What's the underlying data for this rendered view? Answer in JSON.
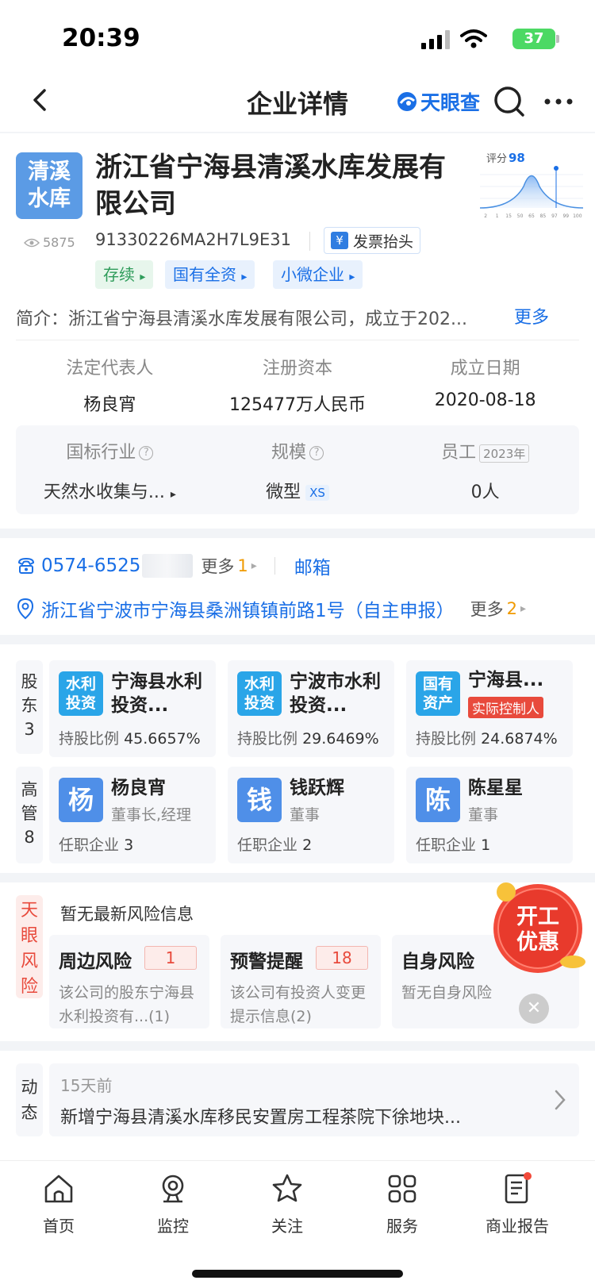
{
  "status_bar": {
    "time": "20:39",
    "battery": "37"
  },
  "nav": {
    "title": "企业详情",
    "brand": "天眼查"
  },
  "company": {
    "logo_line1": "清溪",
    "logo_line2": "水库",
    "name": "浙江省宁海县清溪水库发展有限公司",
    "views": "5875",
    "credit_code": "91330226MA2H7L9E31",
    "invoice_label": "发票抬头",
    "tags": [
      {
        "label": "存续",
        "color": "green"
      },
      {
        "label": "国有全资",
        "color": "blue"
      },
      {
        "label": "小微企业",
        "color": "blue"
      }
    ],
    "score_label": "评分",
    "score": "98",
    "score_ticks": [
      "2",
      "1",
      "15",
      "50",
      "65",
      "85",
      "97",
      "99",
      "100"
    ],
    "intro_label": "简介：",
    "intro_text": "浙江省宁海县清溪水库发展有限公司，成立于202...",
    "intro_more": "更多"
  },
  "key_info": [
    {
      "label": "法定代表人",
      "value": "杨良宵"
    },
    {
      "label": "注册资本",
      "value": "125477万人民币"
    },
    {
      "label": "成立日期",
      "value": "2020-08-18"
    }
  ],
  "info_card": {
    "industry_label": "国标行业",
    "industry_value": "天然水收集与...",
    "scale_label": "规模",
    "scale_value": "微型",
    "scale_badge": "XS",
    "staff_label": "员工",
    "staff_year": "2023年",
    "staff_value": "0人"
  },
  "contact": {
    "phone": "0574-6525",
    "phone_more": "更多",
    "phone_more_count": "1",
    "email": "邮箱",
    "address": "浙江省宁波市宁海县桑洲镇镇前路1号（自主申报）",
    "address_more": "更多",
    "address_more_count": "2"
  },
  "shareholders": {
    "side_label": [
      "股",
      "东",
      "3"
    ],
    "items": [
      {
        "icon": "水利投资",
        "name": "宁海县水利投资...",
        "ratio_label": "持股比例",
        "ratio": "45.6657%"
      },
      {
        "icon": "水利投资",
        "name": "宁波市水利投资...",
        "ratio_label": "持股比例",
        "ratio": "29.6469%"
      },
      {
        "icon": "国有资产",
        "name": "宁海县...",
        "tag": "实际控制人",
        "ratio_label": "持股比例",
        "ratio": "24.6874%"
      }
    ]
  },
  "executives": {
    "side_label": [
      "高",
      "管",
      "8"
    ],
    "items": [
      {
        "avatar": "杨",
        "name": "杨良宵",
        "role": "董事长,经理",
        "count_label": "任职企业",
        "count": "3"
      },
      {
        "avatar": "钱",
        "name": "钱跃辉",
        "role": "董事",
        "count_label": "任职企业",
        "count": "2"
      },
      {
        "avatar": "陈",
        "name": "陈星星",
        "role": "董事",
        "count_label": "任职企业",
        "count": "1"
      }
    ]
  },
  "risk": {
    "side_label": [
      "天",
      "眼",
      "风",
      "险"
    ],
    "title": "暂无最新风险信息",
    "items": [
      {
        "title": "周边风险",
        "count": "1",
        "desc": "该公司的股东宁海县水利投资有...(1)"
      },
      {
        "title": "预警提醒",
        "count": "18",
        "desc": "该公司有投资人变更提示信息(2)"
      },
      {
        "title": "自身风险",
        "count": "",
        "desc": "暂无自身风险"
      }
    ],
    "promo_line1": "开工",
    "promo_line2": "优惠"
  },
  "dynamic": {
    "side_label": [
      "动",
      "态"
    ],
    "time": "15天前",
    "text": "新增宁海县清溪水库移民安置房工程茶院下徐地块..."
  },
  "tabbar": [
    {
      "label": "首页",
      "icon": "home-icon"
    },
    {
      "label": "监控",
      "icon": "monitor-icon"
    },
    {
      "label": "关注",
      "icon": "star-icon"
    },
    {
      "label": "服务",
      "icon": "grid-icon"
    },
    {
      "label": "商业报告",
      "icon": "report-icon"
    }
  ],
  "colors": {
    "accent": "#1a6fe6",
    "warning": "#e84a3c",
    "orange": "#f09a00"
  }
}
